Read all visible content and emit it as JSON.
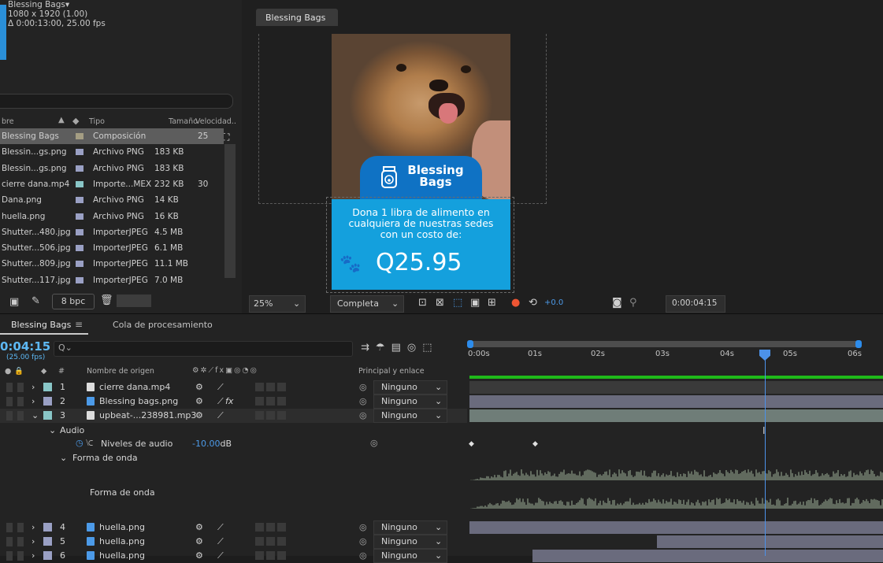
{
  "project": {
    "comp_name": "Blessing Bags▾",
    "comp_size": "1080 x 1920 (1.00)",
    "comp_duration": "Δ 0:00:13:00, 25.00 fps",
    "headers": {
      "name": "bre",
      "type": "Tipo",
      "size": "Tamaño",
      "speed": "Velocidad.."
    },
    "items": [
      {
        "name": "Blessing Bags",
        "type": "Composición",
        "size": "",
        "speed": "25",
        "label_color": "#a49d83",
        "icon": "composition-icon",
        "selected": true
      },
      {
        "name": "Blessin...gs.png",
        "type": "Archivo PNG",
        "size": "183 KB",
        "speed": "",
        "label_color": "#9aa0c4",
        "icon": "png-icon",
        "selected": false
      },
      {
        "name": "Blessin...gs.png",
        "type": "Archivo PNG",
        "size": "183 KB",
        "speed": "",
        "label_color": "#9aa0c4",
        "icon": "png-icon",
        "selected": false
      },
      {
        "name": "cierre dana.mp4",
        "type": "Importe...MEX",
        "size": "232 KB",
        "speed": "30",
        "label_color": "#89c6c7",
        "icon": "video-icon",
        "selected": false
      },
      {
        "name": "Dana.png",
        "type": "Archivo PNG",
        "size": "14 KB",
        "speed": "",
        "label_color": "#9aa0c4",
        "icon": "png-icon",
        "selected": false
      },
      {
        "name": "huella.png",
        "type": "Archivo PNG",
        "size": "16 KB",
        "speed": "",
        "label_color": "#9aa0c4",
        "icon": "png-icon",
        "selected": false
      },
      {
        "name": "Shutter...480.jpg",
        "type": "ImporterJPEG",
        "size": "4.5 MB",
        "speed": "",
        "label_color": "#9aa0c4",
        "icon": "jpg-icon",
        "selected": false
      },
      {
        "name": "Shutter...506.jpg",
        "type": "ImporterJPEG",
        "size": "6.1 MB",
        "speed": "",
        "label_color": "#9aa0c4",
        "icon": "jpg-icon",
        "selected": false
      },
      {
        "name": "Shutter...809.jpg",
        "type": "ImporterJPEG",
        "size": "11.1 MB",
        "speed": "",
        "label_color": "#9aa0c4",
        "icon": "jpg-icon",
        "selected": false
      },
      {
        "name": "Shutter...117.jpg",
        "type": "ImporterJPEG",
        "size": "7.0 MB",
        "speed": "",
        "label_color": "#9aa0c4",
        "icon": "jpg-icon",
        "selected": false
      }
    ],
    "bpc": "8 bpc"
  },
  "viewer": {
    "tab": "Blessing Bags",
    "comp": {
      "logo_line1": "Blessing",
      "logo_line2": "Bags",
      "line1": "Dona 1 libra de alimento en",
      "line2": "cualquiera de nuestras sedes",
      "line3": "con un costo de:",
      "price": "Q25.95"
    },
    "zoom": "25%",
    "resolution": "Completa",
    "exposure": "+0.0",
    "timecode": "0:00:04:15"
  },
  "timeline": {
    "tab": "Blessing Bags",
    "tab2": "Cola de procesamiento",
    "current_time": "0:04:15",
    "fps": "(25.00 fps)",
    "col_source": "Nombre de origen",
    "col_parent": "Principal y enlace",
    "col_num": "#",
    "ticks": [
      "0:00s",
      "01s",
      "02s",
      "03s",
      "04s",
      "05s",
      "06s"
    ],
    "layers": [
      {
        "num": "1",
        "name": "cierre dana.mp4",
        "label": "#89c6c7",
        "parent": "Ninguno",
        "fx": ""
      },
      {
        "num": "2",
        "name": "Blessing bags.png",
        "label": "#9aa0c4",
        "parent": "Ninguno",
        "fx": "fx"
      },
      {
        "num": "3",
        "name": "upbeat-...238981.mp3",
        "label": "#89c6c7",
        "parent": "Ninguno",
        "fx": ""
      },
      {
        "num": "4",
        "name": "huella.png",
        "label": "#9aa0c4",
        "parent": "Ninguno",
        "fx": ""
      },
      {
        "num": "5",
        "name": "huella.png",
        "label": "#9aa0c4",
        "parent": "Ninguno",
        "fx": ""
      },
      {
        "num": "6",
        "name": "huella.png",
        "label": "#9aa0c4",
        "parent": "Ninguno",
        "fx": ""
      }
    ],
    "audio_group": "Audio",
    "audio_levels_label": "Niveles de audio",
    "audio_levels_value": "-10.00",
    "audio_levels_unit": "dB",
    "waveform_group": "Forma de onda",
    "waveform_label": "Forma de onda"
  }
}
